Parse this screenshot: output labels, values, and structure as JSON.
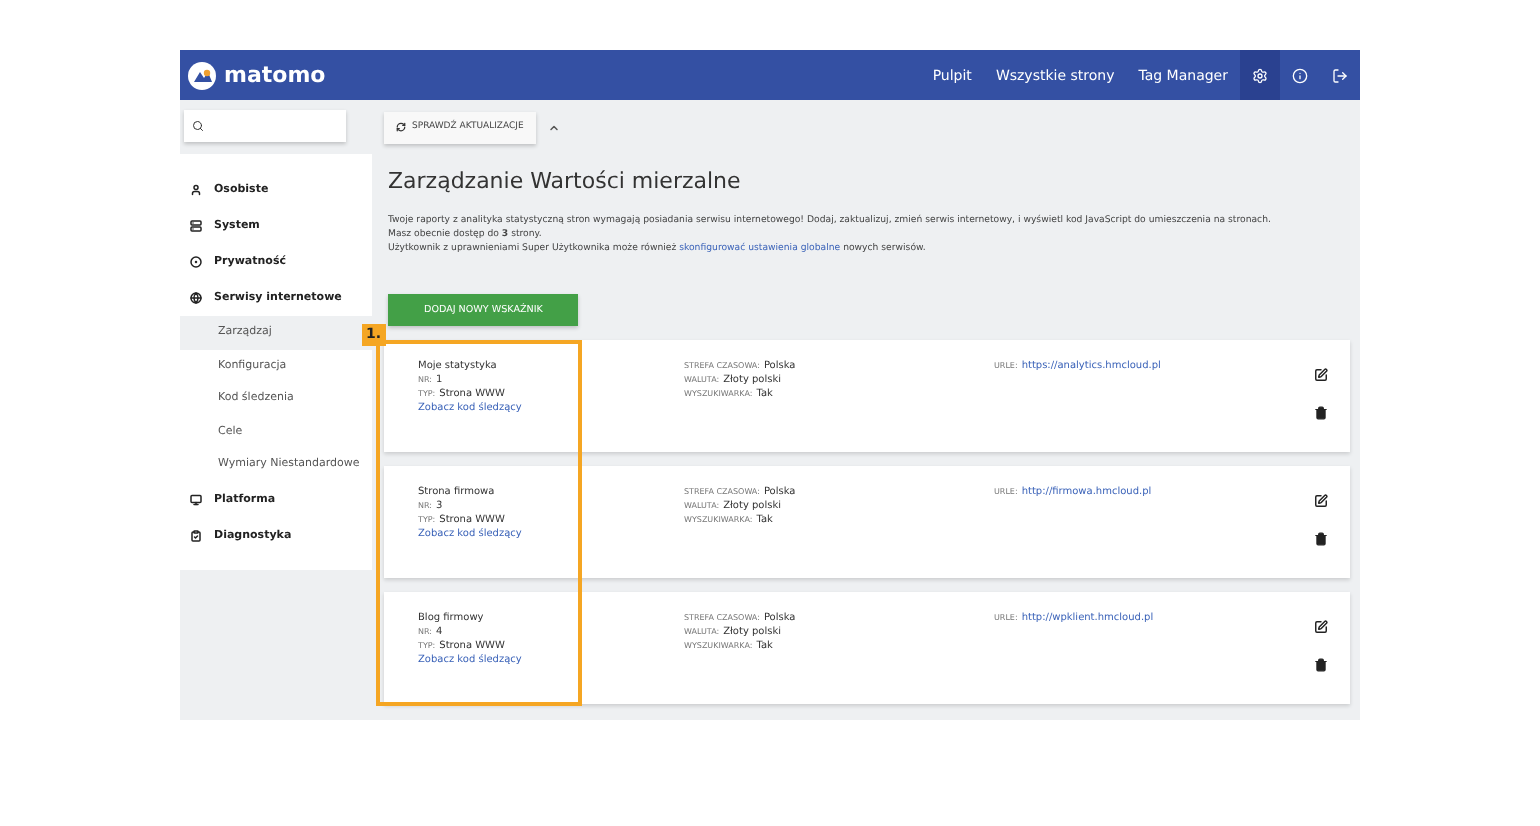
{
  "header": {
    "logo": "matomo",
    "links": [
      "Pulpit",
      "Wszystkie strony",
      "Tag Manager"
    ],
    "icons": [
      {
        "kind": "settings",
        "selected": true
      },
      {
        "kind": "info",
        "selected": false
      },
      {
        "kind": "logout",
        "selected": false
      }
    ]
  },
  "toolbar": {
    "update_button": "SPRAWDŹ AKTUALIZACJE"
  },
  "sidebar": {
    "sections": [
      {
        "label": "Osobiste"
      },
      {
        "label": "System"
      },
      {
        "label": "Prywatność"
      },
      {
        "label": "Serwisy internetowe",
        "children": [
          {
            "label": "Zarządzaj",
            "selected": true
          },
          {
            "label": "Konfiguracja",
            "selected": false
          },
          {
            "label": "Kod śledzenia",
            "selected": false
          },
          {
            "label": "Cele",
            "selected": false
          },
          {
            "label": "Wymiary Niestandardowe",
            "selected": false
          }
        ]
      },
      {
        "label": "Platforma"
      },
      {
        "label": "Diagnostyka"
      }
    ]
  },
  "title": "Zarządzanie Wartości mierzalne",
  "description": [
    "Twoje raporty z analityka statystyczną stron wymagają posiadania serwisu internetowego! Dodaj, zaktualizuj, zmień serwis internetowy, i wyświetl kod JavaScript do umieszczenia na stronach.",
    "Masz obecnie dostęp do **3** strony."
  ],
  "description_link_line": {
    "before": "Użytkownik z uprawnieniami Super Użytkownika może również",
    "link": "skonfigurować ustawienia globalne",
    "after": "nowych serwisów."
  },
  "add_button": "DODAJ NOWY WSKAŹNIK",
  "sites": [
    {
      "name": "Moje statystyka",
      "fields": [
        {
          "label": "NR:",
          "value": "1"
        },
        {
          "label": "TYP:",
          "value": "Strona WWW"
        }
      ],
      "code_link": "Zobacz kod śledzący",
      "details": [
        {
          "label": "STREFA CZASOWA:",
          "value": "Polska"
        },
        {
          "label": "WALUTA:",
          "value": "Złoty polski"
        },
        {
          "label": "WYSZUKIWARKA:",
          "value": "Tak"
        }
      ],
      "urls_label": "URLE:",
      "url": "https://analytics.hmcloud.pl"
    },
    {
      "name": "Strona firmowa",
      "fields": [
        {
          "label": "NR:",
          "value": "3"
        },
        {
          "label": "TYP:",
          "value": "Strona WWW"
        }
      ],
      "code_link": "Zobacz kod śledzący",
      "details": [
        {
          "label": "STREFA CZASOWA:",
          "value": "Polska"
        },
        {
          "label": "WALUTA:",
          "value": "Złoty polski"
        },
        {
          "label": "WYSZUKIWARKA:",
          "value": "Tak"
        }
      ],
      "urls_label": "URLE:",
      "url": "http://firmowa.hmcloud.pl"
    },
    {
      "name": "Blog firmowy",
      "fields": [
        {
          "label": "NR:",
          "value": "4"
        },
        {
          "label": "TYP:",
          "value": "Strona WWW"
        }
      ],
      "code_link": "Zobacz kod śledzący",
      "details": [
        {
          "label": "STREFA CZASOWA:",
          "value": "Polska"
        },
        {
          "label": "WALUTA:",
          "value": "Złoty polski"
        },
        {
          "label": "WYSZUKIWARKA:",
          "value": "Tak"
        }
      ],
      "urls_label": "URLE:",
      "url": "http://wpklient.hmcloud.pl"
    }
  ],
  "annotation": {
    "label": "1."
  }
}
